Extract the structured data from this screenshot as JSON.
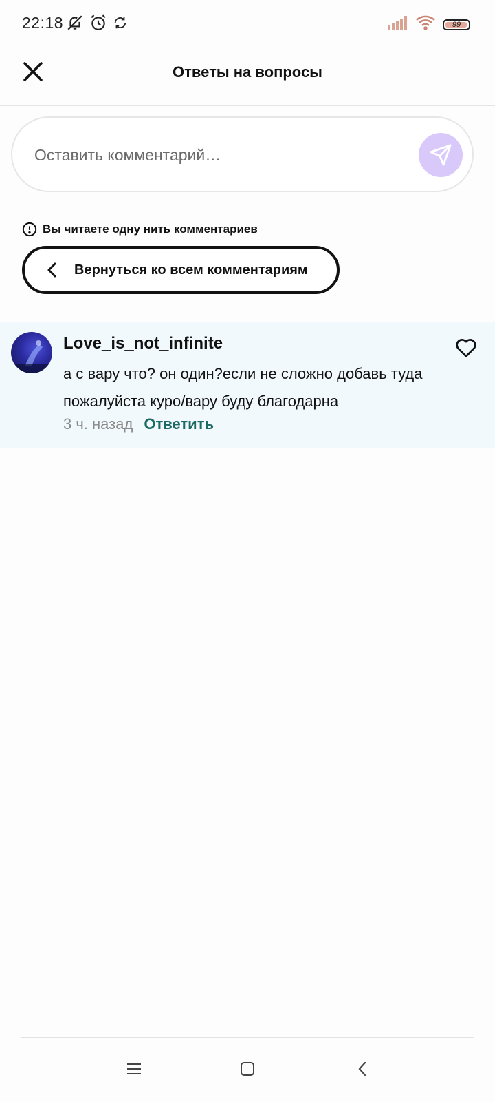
{
  "status_bar": {
    "time": "22:18",
    "battery_level": "99",
    "icons": [
      "bell-off-icon",
      "alarm-icon",
      "sync-icon",
      "signal-icon",
      "wifi-icon",
      "battery-icon"
    ]
  },
  "header": {
    "title": "Ответы на вопросы",
    "close_icon": "close-icon"
  },
  "comment_input": {
    "placeholder": "Оставить комментарий…",
    "send_icon": "send-icon",
    "send_color": "#d9c9fb"
  },
  "thread_notice": {
    "text": "Вы читаете одну нить комментариев",
    "icon": "info-icon"
  },
  "back_button": {
    "label": "Вернуться ко всем комментариям",
    "icon": "chevron-left-icon"
  },
  "comment": {
    "author": "Love_is_not_infinite",
    "text": "а с вару что? он один?если не сложно добавь туда пожалуйста куро/вару буду благодарна",
    "time": "3 ч. назад",
    "reply_label": "Ответить",
    "reply_color": "#1b6b63",
    "background": "#f1f9fd",
    "like_icon": "heart-outline-icon"
  },
  "nav_bar": {
    "icons": [
      "menu-icon",
      "home-square-icon",
      "back-icon"
    ]
  }
}
